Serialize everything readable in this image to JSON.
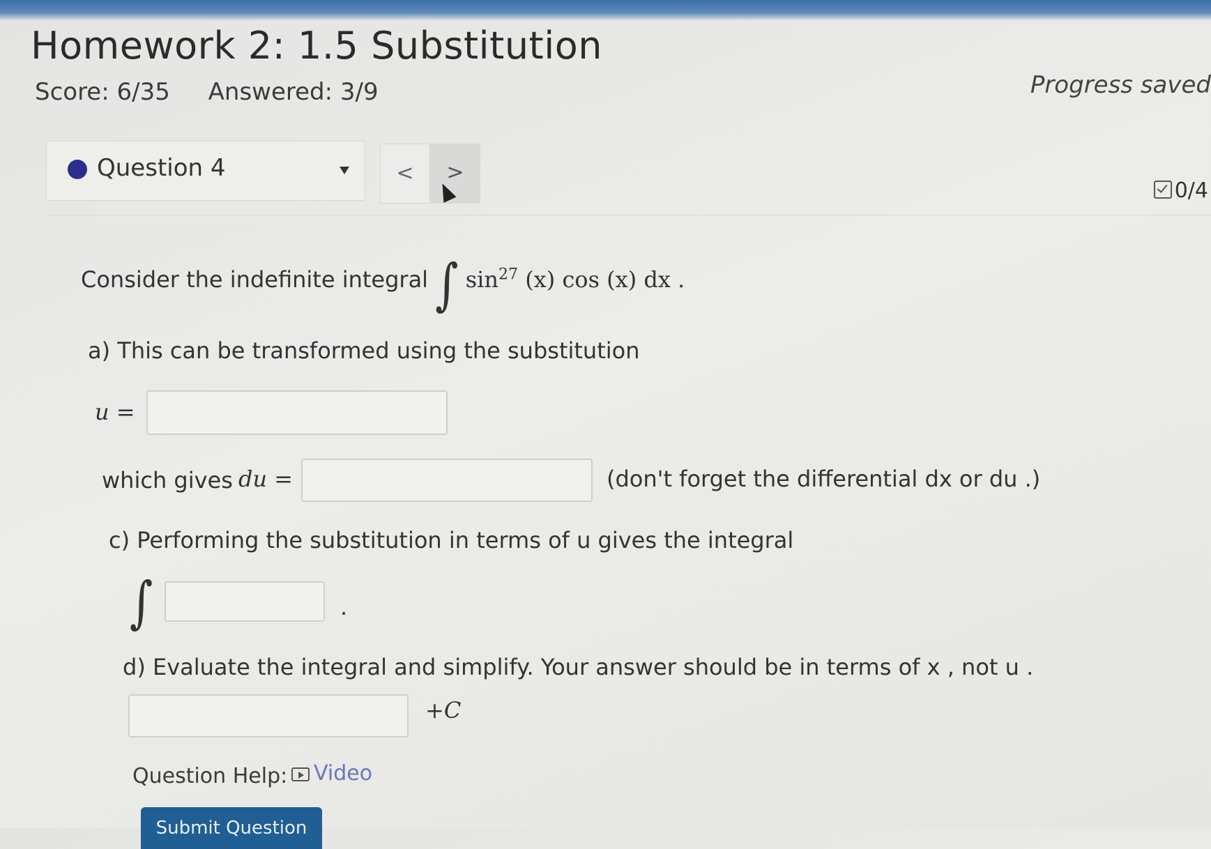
{
  "header": {
    "title": "Homework 2: 1.5 Substitution",
    "score": "Score: 6/35",
    "answered": "Answered: 3/9",
    "progress_status": "Progress saved"
  },
  "question_nav": {
    "current_question": "Question 4",
    "prev_symbol": "<",
    "next_symbol": ">",
    "points": "0/4"
  },
  "question": {
    "intro": "Consider the indefinite integral",
    "integrand_sin": "sin",
    "exponent": "27",
    "integrand_rest": "(x) cos (x) dx .",
    "part_a": "a) This can be transformed using the substitution",
    "u_label": "u =",
    "u_value": "",
    "which_gives": "which gives",
    "du_label": "du =",
    "du_value": "",
    "differential_note": "(don't forget the differential dx or du .)",
    "part_c": "c) Performing the substitution in terms of u gives the integral",
    "integral_value": "",
    "period": ".",
    "part_d": "d) Evaluate the integral and simplify. Your answer should be in terms of x , not u .",
    "antiderivative_value": "",
    "plus_c": "+C"
  },
  "help": {
    "label": "Question Help:",
    "video_link": "Video"
  },
  "submit": {
    "label": "Submit Question"
  }
}
